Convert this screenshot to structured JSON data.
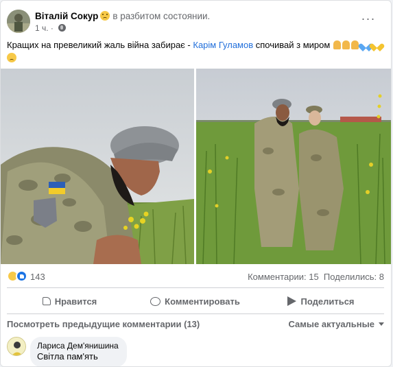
{
  "post": {
    "author": "Віталій Сокур",
    "feeling": "в разбитом состоянии.",
    "time": "1 ч.",
    "text_before": "Кращих на превеликий жаль війна забирає - ",
    "mention": "Карім Гуламов",
    "text_after": " спочивай з миром"
  },
  "icons": {
    "more": "more-dots-icon",
    "privacy": "globe-icon",
    "feeling": "disappointed-face-icon"
  },
  "stats": {
    "reactions_count": "143",
    "comments_label": "Комментарии: 15",
    "shares_label": "Поделились: 8"
  },
  "actions": {
    "like": "Нравится",
    "comment": "Комментировать",
    "share": "Поделиться"
  },
  "comments": {
    "previous": "Посмотреть предыдущие комментарии (13)",
    "sort": "Самые актуальные",
    "items": [
      {
        "author": "Лариса Дем'янишина",
        "text": "Світла пам'ять"
      }
    ]
  },
  "colors": {
    "link": "#216fdb",
    "like_blue": "#1b74e4",
    "muted": "#65676b"
  }
}
